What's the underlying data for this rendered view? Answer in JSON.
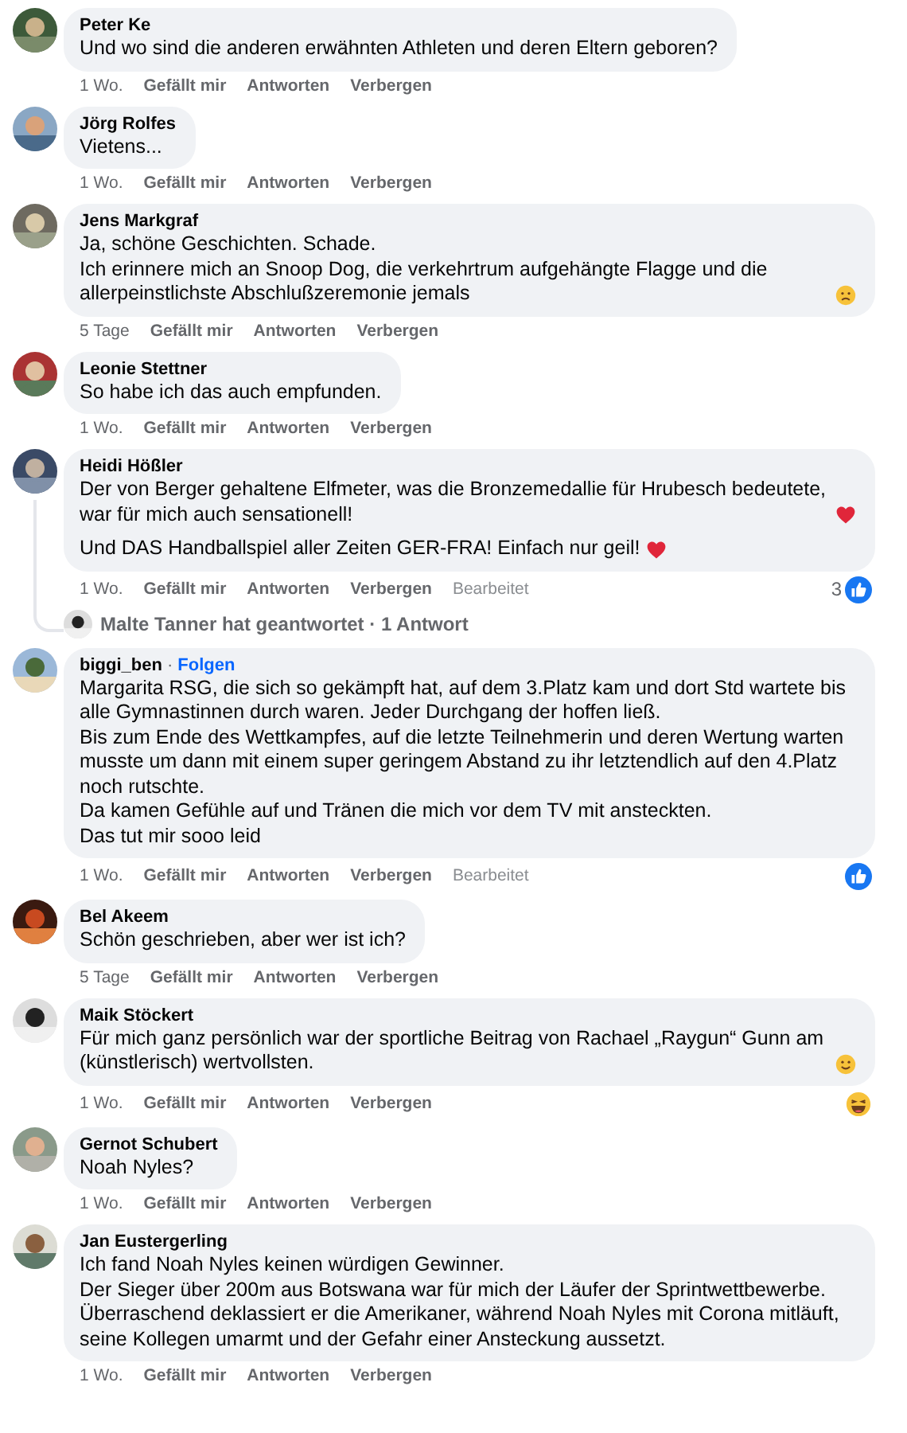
{
  "comments": [
    {
      "author": "Peter Ke",
      "paragraphs": [
        {
          "lines": [
            {
              "kind": "plain",
              "text": "Und wo sind die anderen erwähnten Athleten und deren Eltern geboren?"
            }
          ]
        }
      ],
      "time": "1 Wo.",
      "actions": [
        "Gefällt mir",
        "Antworten",
        "Verbergen"
      ]
    },
    {
      "author": "Jörg Rolfes",
      "paragraphs": [
        {
          "lines": [
            {
              "kind": "plain",
              "text": "Vietens..."
            }
          ]
        }
      ],
      "time": "1 Wo.",
      "actions": [
        "Gefällt mir",
        "Antworten",
        "Verbergen"
      ]
    },
    {
      "author": "Jens Markgraf",
      "paragraphs": [
        {
          "lines": [
            {
              "kind": "plain",
              "text": "Ja, schöne Geschichten. Schade."
            },
            {
              "kind": "sad",
              "text": "Ich erinnere mich an Snoop Dog, die verkehrtrum aufgehängte Flagge und die allerpeinstlichste Abschlußzeremonie jemals"
            }
          ]
        }
      ],
      "time": "5 Tage",
      "actions": [
        "Gefällt mir",
        "Antworten",
        "Verbergen"
      ]
    },
    {
      "author": "Leonie Stettner",
      "paragraphs": [
        {
          "lines": [
            {
              "kind": "plain",
              "text": "So habe ich das auch empfunden."
            }
          ]
        }
      ],
      "time": "1 Wo.",
      "actions": [
        "Gefällt mir",
        "Antworten",
        "Verbergen"
      ]
    },
    {
      "author": "Heidi Hößler",
      "paragraphs": [
        {
          "lines": [
            {
              "kind": "heart",
              "text": "Der von Berger gehaltene Elfmeter, was die Bronzemedallie für Hrubesch bedeutete, war für mich auch sensationell!"
            }
          ]
        },
        {
          "lines": [
            {
              "kind": "heart",
              "text": "Und DAS Handballspiel aller Zeiten GER-FRA! Einfach nur geil!"
            }
          ]
        }
      ],
      "time": "1 Wo.",
      "actions": [
        "Gefällt mir",
        "Antworten",
        "Verbergen"
      ],
      "edited": "Bearbeitet",
      "reactions": {
        "kind": "like",
        "count": "3"
      },
      "replies": "Malte Tanner hat geantwortet · 1 Antwort"
    },
    {
      "author": "biggi_ben",
      "separator": "·",
      "follow": "Folgen",
      "paragraphs": [
        {
          "lines": [
            {
              "kind": "plain",
              "text": "Margarita RSG, die sich so gekämpft hat, auf dem 3.Platz kam und dort Std wartete bis alle Gymnastinnen durch waren. Jeder Durchgang der hoffen ließ."
            },
            {
              "kind": "plain",
              "text": "Bis zum Ende des Wettkampfes, auf die letzte Teilnehmerin und deren Wertung warten musste um dann mit einem super geringem Abstand zu ihr letztendlich auf den 4.Platz noch rutschte."
            },
            {
              "kind": "plain",
              "text": "Da kamen Gefühle auf und Tränen die mich vor dem TV mit ansteckten."
            },
            {
              "kind": "plain",
              "text": "Das tut mir sooo leid"
            }
          ]
        }
      ],
      "time": "1 Wo.",
      "actions": [
        "Gefällt mir",
        "Antworten",
        "Verbergen"
      ],
      "edited": "Bearbeitet",
      "reactions": {
        "kind": "like"
      }
    },
    {
      "author": "Bel Akeem",
      "paragraphs": [
        {
          "lines": [
            {
              "kind": "plain",
              "text": "Schön geschrieben, aber wer ist ich?"
            }
          ]
        }
      ],
      "time": "5 Tage",
      "actions": [
        "Gefällt mir",
        "Antworten",
        "Verbergen"
      ]
    },
    {
      "author": "Maik Stöckert",
      "paragraphs": [
        {
          "lines": [
            {
              "kind": "smile",
              "text": "Für mich ganz persönlich war der sportliche Beitrag von Rachael „Raygun“ Gunn am (künstlerisch) wertvollsten."
            }
          ]
        }
      ],
      "time": "1 Wo.",
      "actions": [
        "Gefällt mir",
        "Antworten",
        "Verbergen"
      ],
      "reactions": {
        "kind": "haha"
      }
    },
    {
      "author": "Gernot Schubert",
      "paragraphs": [
        {
          "lines": [
            {
              "kind": "plain",
              "text": "Noah Nyles?"
            }
          ]
        }
      ],
      "time": "1 Wo.",
      "actions": [
        "Gefällt mir",
        "Antworten",
        "Verbergen"
      ]
    },
    {
      "author": "Jan Eustergerling",
      "paragraphs": [
        {
          "lines": [
            {
              "kind": "plain",
              "text": "Ich fand Noah Nyles keinen würdigen Gewinner."
            },
            {
              "kind": "plain",
              "text": "Der Sieger über 200m aus Botswana war für mich der Läufer der Sprintwettbewerbe. Überraschend deklassiert er die Amerikaner, während Noah Nyles mit Corona mitläuft, seine Kollegen umarmt und der Gefahr einer Ansteckung aussetzt."
            }
          ]
        }
      ],
      "time": "1 Wo.",
      "actions": [
        "Gefällt mir",
        "Antworten",
        "Verbergen"
      ]
    }
  ]
}
